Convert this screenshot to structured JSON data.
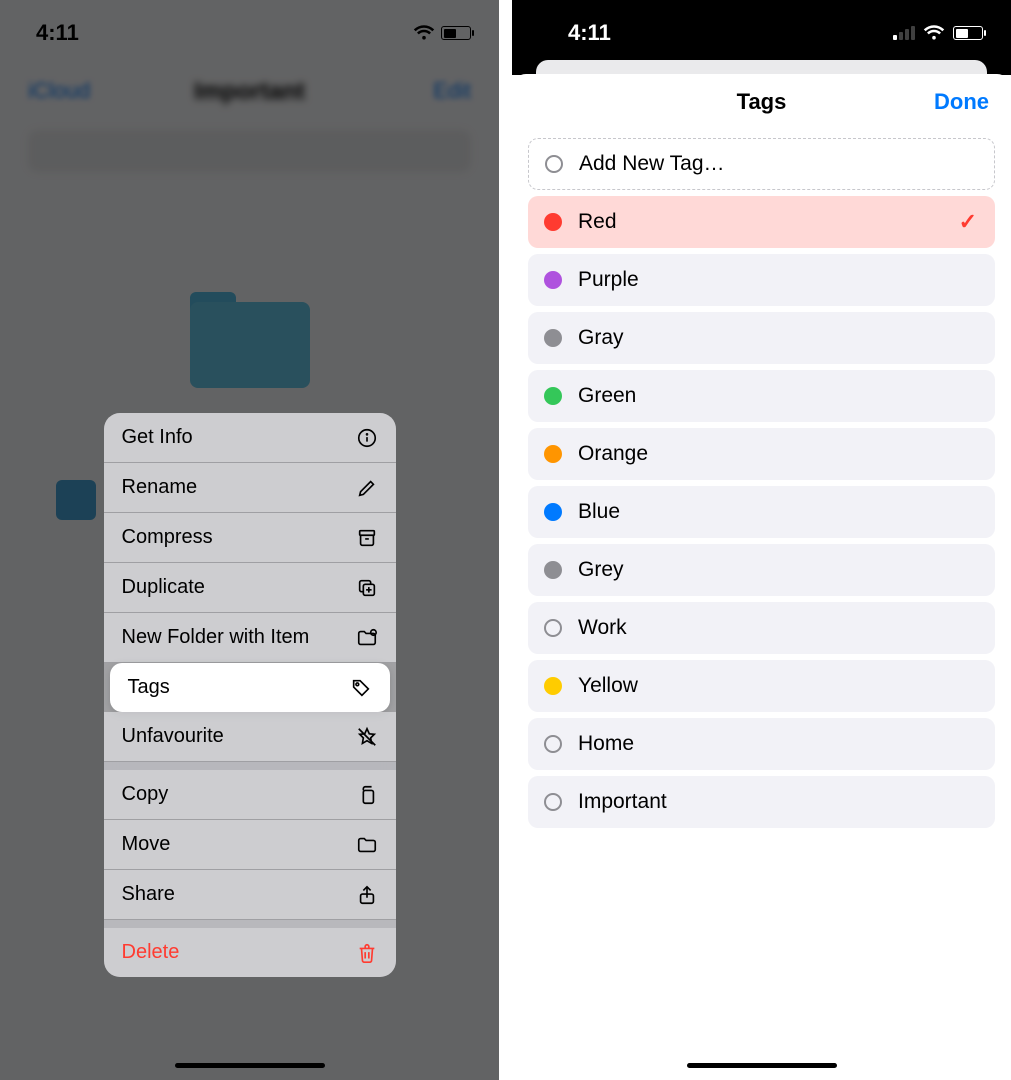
{
  "status_time": "4:11",
  "left": {
    "nav_back": "iCloud",
    "nav_title": "Important",
    "nav_action": "Edit",
    "menu": {
      "getinfo": "Get Info",
      "rename": "Rename",
      "compress": "Compress",
      "duplicate": "Duplicate",
      "newfolder": "New Folder with Item",
      "tags": "Tags",
      "unfavourite": "Unfavourite",
      "copy": "Copy",
      "move": "Move",
      "share": "Share",
      "delete": "Delete"
    }
  },
  "right": {
    "title": "Tags",
    "done": "Done",
    "add_new": "Add New Tag…",
    "tags": {
      "red": {
        "label": "Red",
        "color": "#ff3b30",
        "selected": true
      },
      "purple": {
        "label": "Purple",
        "color": "#af52de"
      },
      "gray": {
        "label": "Gray",
        "color": "#8e8e93"
      },
      "green": {
        "label": "Green",
        "color": "#34c759"
      },
      "orange": {
        "label": "Orange",
        "color": "#ff9500"
      },
      "blue": {
        "label": "Blue",
        "color": "#007aff"
      },
      "grey": {
        "label": "Grey",
        "color": "#8e8e93"
      },
      "work": {
        "label": "Work",
        "hollow": true
      },
      "yellow": {
        "label": "Yellow",
        "color": "#ffcc00"
      },
      "home": {
        "label": "Home",
        "hollow": true
      },
      "important": {
        "label": "Important",
        "hollow": true
      }
    }
  }
}
